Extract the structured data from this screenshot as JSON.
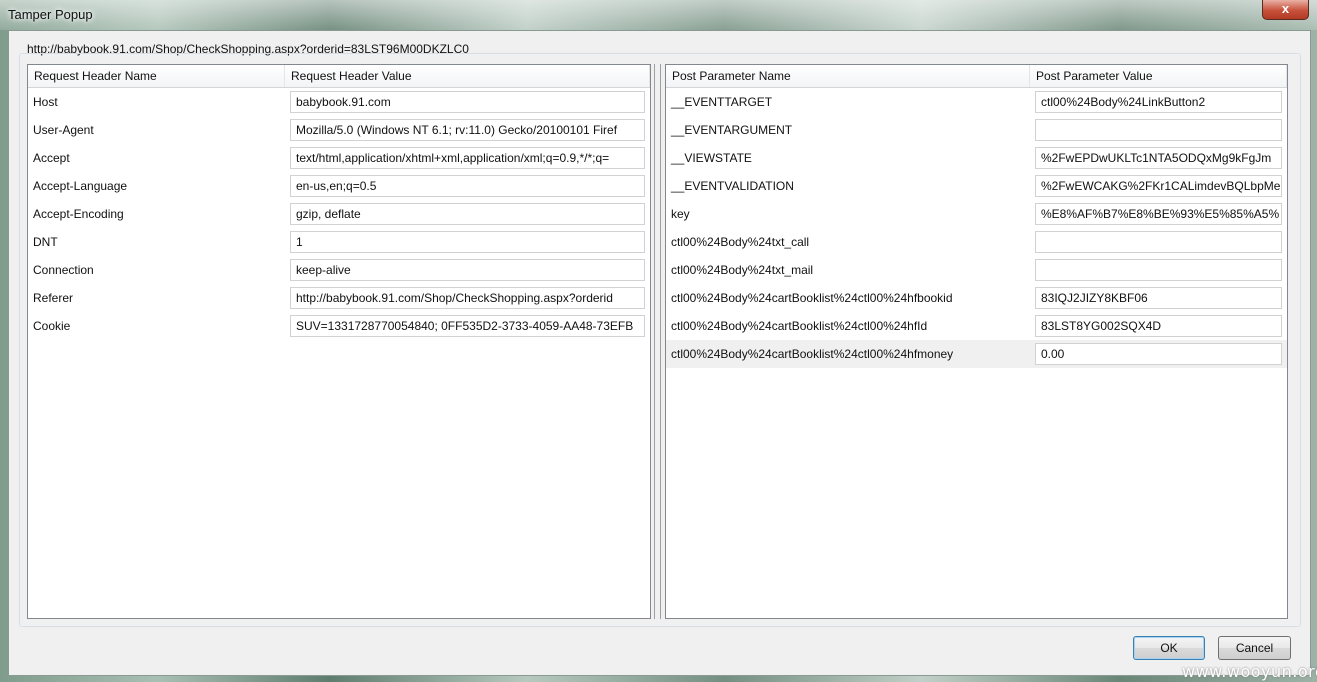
{
  "window": {
    "title": "Tamper Popup",
    "close_label": "x"
  },
  "url": "http://babybook.91.com/Shop/CheckShopping.aspx?orderid=83LST96M00DKZLC0",
  "headers_panel": {
    "col_name": "Request Header Name",
    "col_value": "Request Header Value",
    "rows": [
      {
        "name": "Host",
        "value": "babybook.91.com"
      },
      {
        "name": "User-Agent",
        "value": "Mozilla/5.0 (Windows NT 6.1; rv:11.0) Gecko/20100101 Firef"
      },
      {
        "name": "Accept",
        "value": "text/html,application/xhtml+xml,application/xml;q=0.9,*/*;q="
      },
      {
        "name": "Accept-Language",
        "value": "en-us,en;q=0.5"
      },
      {
        "name": "Accept-Encoding",
        "value": "gzip, deflate"
      },
      {
        "name": "DNT",
        "value": "1"
      },
      {
        "name": "Connection",
        "value": "keep-alive"
      },
      {
        "name": "Referer",
        "value": "http://babybook.91.com/Shop/CheckShopping.aspx?orderid"
      },
      {
        "name": "Cookie",
        "value": "SUV=1331728770054840; 0FF535D2-3733-4059-AA48-73EFB"
      }
    ]
  },
  "params_panel": {
    "col_name": "Post Parameter Name",
    "col_value": "Post Parameter Value",
    "rows": [
      {
        "name": "__EVENTTARGET",
        "value": "ctl00%24Body%24LinkButton2"
      },
      {
        "name": "__EVENTARGUMENT",
        "value": ""
      },
      {
        "name": "__VIEWSTATE",
        "value": "%2FwEPDwUKLTc1NTA5ODQxMg9kFgJm"
      },
      {
        "name": "__EVENTVALIDATION",
        "value": "%2FwEWCAKG%2FKr1CALimdevBQLbpMe"
      },
      {
        "name": "key",
        "value": "%E8%AF%B7%E8%BE%93%E5%85%A5%"
      },
      {
        "name": "ctl00%24Body%24txt_call",
        "value": ""
      },
      {
        "name": "ctl00%24Body%24txt_mail",
        "value": ""
      },
      {
        "name": "ctl00%24Body%24cartBooklist%24ctl00%24hfbookid",
        "value": "83IQJ2JIZY8KBF06"
      },
      {
        "name": "ctl00%24Body%24cartBooklist%24ctl00%24hfId",
        "value": "83LST8YG002SQX4D"
      },
      {
        "name": "ctl00%24Body%24cartBooklist%24ctl00%24hfmoney",
        "value": "0.00"
      }
    ],
    "highlighted_row_index": 9
  },
  "buttons": {
    "ok": "OK",
    "cancel": "Cancel"
  },
  "watermark": "www.wooyun.org"
}
